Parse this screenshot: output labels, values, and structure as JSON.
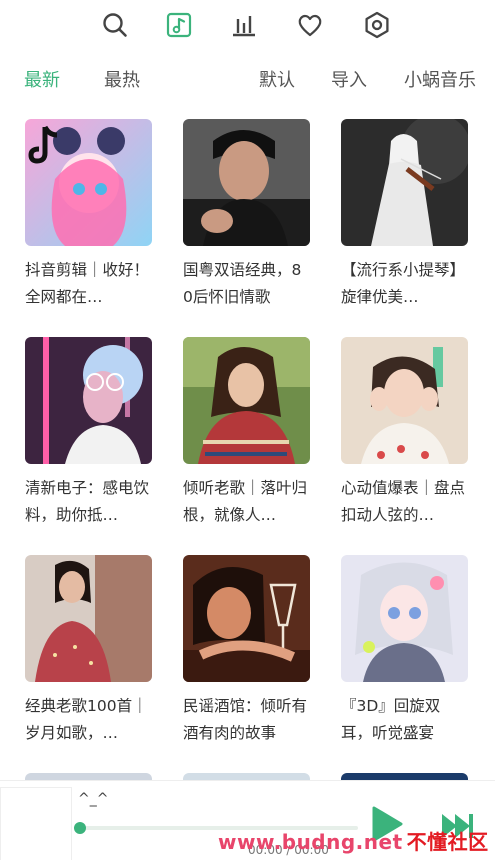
{
  "nav": {
    "icons": [
      "search-icon",
      "music-note-icon",
      "chart-bars-icon",
      "heart-icon",
      "settings-icon"
    ],
    "active_color": "#3bb37c"
  },
  "tabs": {
    "latest": "最新",
    "hot": "最热",
    "default": "默认",
    "import": "导入",
    "source": "小蜗音乐"
  },
  "playlists": [
    {
      "title": "抖音剪辑｜收好！全网都在…"
    },
    {
      "title": "国粤双语经典，80后怀旧情歌"
    },
    {
      "title": "【流行系小提琴】旋律优美…"
    },
    {
      "title": "清新电子：感电饮料，助你抵…"
    },
    {
      "title": "倾听老歌｜落叶归根，就像人…"
    },
    {
      "title": "心动值爆表｜盘点扣动人弦的…"
    },
    {
      "title": "经典老歌100首｜岁月如歌，…"
    },
    {
      "title": "民谣酒馆：倾听有酒有肉的故事"
    },
    {
      "title": "『3D』回旋双耳，听觉盛宴"
    }
  ],
  "player": {
    "song": "^_^",
    "time": "00:00 / 00:00",
    "progress": 0
  },
  "watermark": {
    "site": "www.budng.net",
    "name": "不懂社区"
  }
}
